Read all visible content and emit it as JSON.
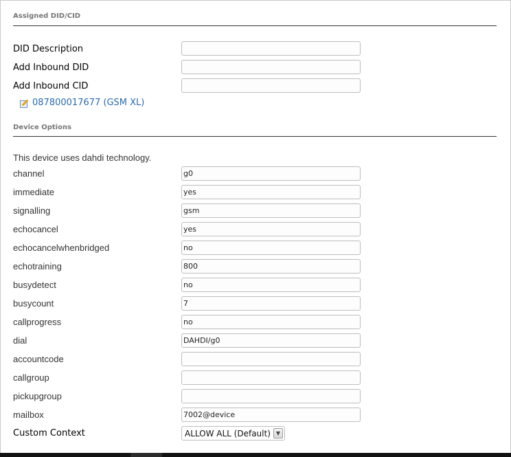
{
  "sections": {
    "assigned_title": "Assigned DID/CID",
    "device_title": "Device Options"
  },
  "assigned": {
    "did_description_label": "DID Description",
    "did_description_value": "",
    "inbound_did_label": "Add Inbound DID",
    "inbound_did_value": "",
    "inbound_cid_label": "Add Inbound CID",
    "inbound_cid_value": "",
    "existing_did": "087800017677 (GSM XL)"
  },
  "device": {
    "technology_note": "This device uses dahdi technology.",
    "fields": [
      {
        "label": "channel",
        "value": "g0"
      },
      {
        "label": "immediate",
        "value": "yes"
      },
      {
        "label": "signalling",
        "value": "gsm"
      },
      {
        "label": "echocancel",
        "value": "yes"
      },
      {
        "label": "echocancelwhenbridged",
        "value": "no"
      },
      {
        "label": "echotraining",
        "value": "800"
      },
      {
        "label": "busydetect",
        "value": "no"
      },
      {
        "label": "busycount",
        "value": "7"
      },
      {
        "label": "callprogress",
        "value": "no"
      },
      {
        "label": "dial",
        "value": "DAHDI/g0"
      },
      {
        "label": "accountcode",
        "value": ""
      },
      {
        "label": "callgroup",
        "value": ""
      },
      {
        "label": "pickupgroup",
        "value": ""
      },
      {
        "label": "mailbox",
        "value": "7002@device"
      }
    ],
    "custom_context_label": "Custom Context",
    "custom_context_selected": "ALLOW ALL (Default)"
  },
  "icons": {
    "edit": "edit-icon",
    "dropdown": "chevron-down-icon"
  },
  "colors": {
    "link": "#2a6bb0",
    "rule": "#333333",
    "section_title": "#777777"
  }
}
